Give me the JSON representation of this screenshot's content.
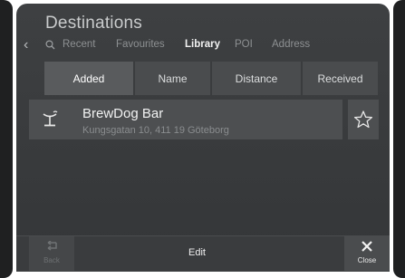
{
  "header": {
    "title": "Destinations"
  },
  "nav": {
    "back_icon": "chevron-left-icon",
    "search_icon": "search-icon",
    "items": [
      {
        "label": "Recent",
        "active": false
      },
      {
        "label": "Favourites",
        "active": false
      },
      {
        "label": "Library",
        "active": true
      },
      {
        "label": "POI",
        "active": false
      },
      {
        "label": "Address",
        "active": false
      }
    ]
  },
  "sort_tabs": [
    {
      "label": "Added",
      "active": true
    },
    {
      "label": "Name",
      "active": false
    },
    {
      "label": "Distance",
      "active": false
    },
    {
      "label": "Received",
      "active": false
    }
  ],
  "list": [
    {
      "icon": "bar-cocktail-icon",
      "name": "BrewDog Bar",
      "address": "Kungsgatan 10, 411 19 Göteborg",
      "favourite_icon": "star-outline-icon"
    }
  ],
  "bottom_bar": {
    "back_label": "Back",
    "edit_label": "Edit",
    "close_label": "Close"
  },
  "colors": {
    "background": "#3e4042",
    "item_background": "#4d4f51",
    "text_primary": "#f1f2f2",
    "text_muted": "#8d9092"
  }
}
